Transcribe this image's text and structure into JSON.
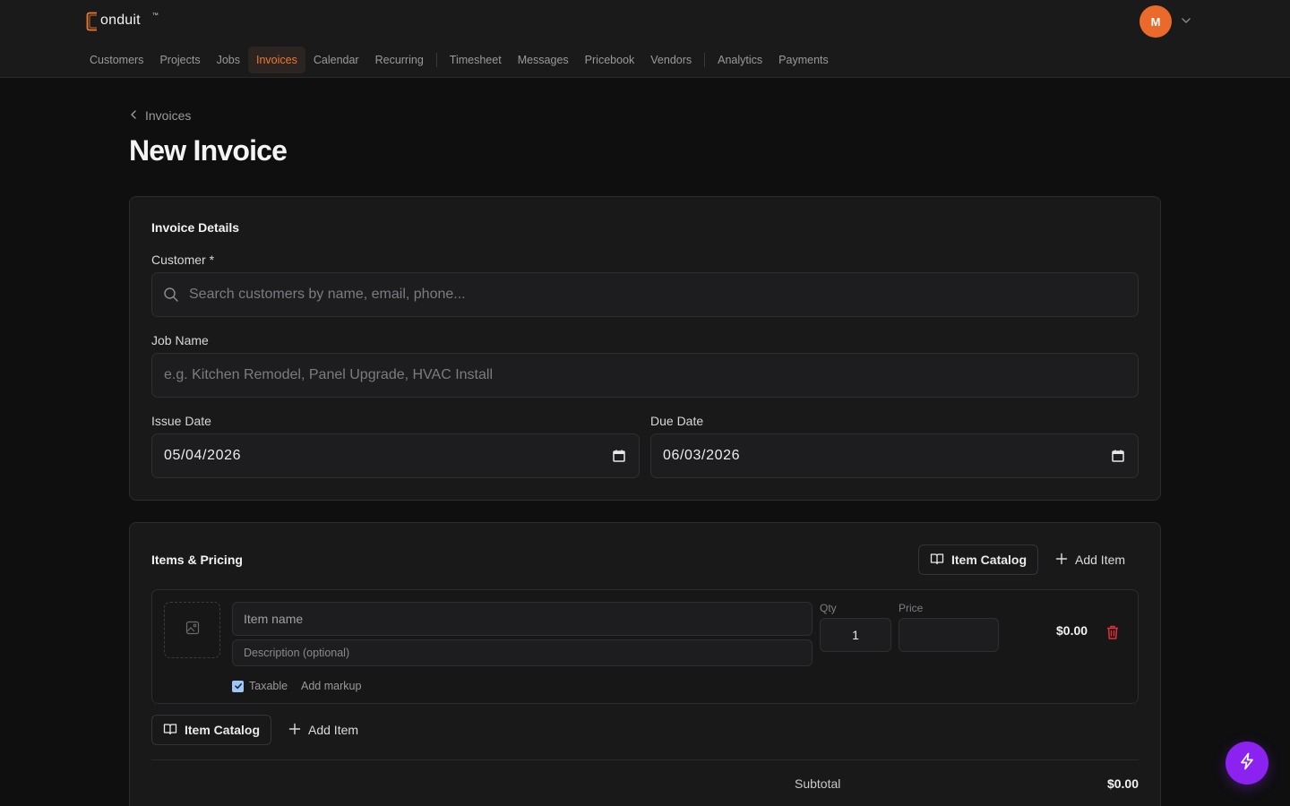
{
  "app": {
    "logo_text": "onduit",
    "logo_tm": "™",
    "avatar_initial": "M"
  },
  "nav": {
    "items": [
      "Customers",
      "Projects",
      "Jobs",
      "Invoices",
      "Calendar",
      "Recurring",
      "Timesheet",
      "Messages",
      "Pricebook",
      "Vendors",
      "Analytics",
      "Payments"
    ],
    "active": "Invoices"
  },
  "breadcrumb": {
    "label": "Invoices"
  },
  "page": {
    "title": "New Invoice"
  },
  "details": {
    "title": "Invoice Details",
    "customer_label": "Customer *",
    "customer_placeholder": "Search customers by name, email, phone...",
    "job_label": "Job Name",
    "job_placeholder": "e.g. Kitchen Remodel, Panel Upgrade, HVAC Install",
    "issue_label": "Issue Date",
    "issue_value": "05/04/2026",
    "due_label": "Due Date",
    "due_value": "06/03/2026"
  },
  "items": {
    "title": "Items & Pricing",
    "catalog_label": "Item Catalog",
    "add_label": "Add Item",
    "row": {
      "name_placeholder": "Item name",
      "desc_placeholder": "Description (optional)",
      "qty_label": "Qty",
      "qty_value": "1",
      "price_label": "Price",
      "price_value": "",
      "total": "$0.00",
      "taxable_label": "Taxable",
      "taxable_checked": true,
      "markup_label": "Add markup"
    },
    "subtotal_label": "Subtotal",
    "subtotal_value": "$0.00"
  },
  "colors": {
    "accent": "#f0782f",
    "avatar": "#ea6a2c",
    "fab": "#8b22f0",
    "delete": "#e0313a"
  }
}
